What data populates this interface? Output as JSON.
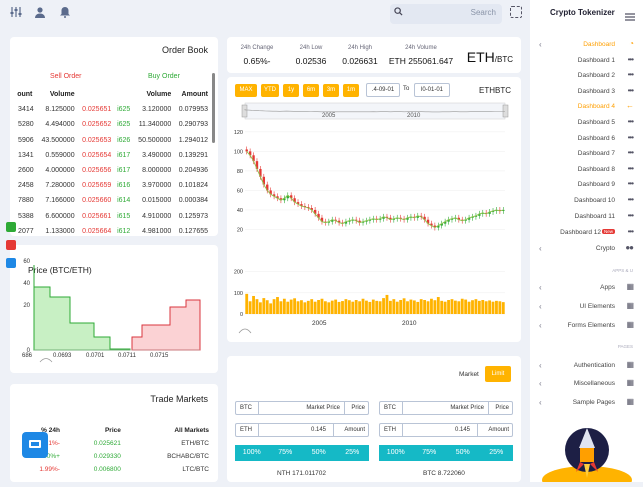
{
  "topbar": {
    "search_placeholder": "Search"
  },
  "order_book": {
    "title": "Order Book",
    "sell_label": "Sell Order",
    "buy_label": "Buy Order",
    "headers": [
      "ount",
      "Volume",
      "",
      "",
      "Volume",
      "Amount"
    ],
    "rows": [
      [
        "3414",
        "8.125000",
        "0.025651",
        "i625",
        "3.120000",
        "0.079953"
      ],
      [
        "5280",
        "4.494000",
        "0.025652",
        "i625",
        "11.340000",
        "0.290793"
      ],
      [
        "5906",
        "43.500000",
        "0.025653",
        "i626",
        "50.500000",
        "1.294012"
      ],
      [
        "1341",
        "0.559000",
        "0.025654",
        "i617",
        "3.490000",
        "0.139291"
      ],
      [
        "2600",
        "4.000000",
        "0.025656",
        "i617",
        "8.000000",
        "0.204936"
      ],
      [
        "2458",
        "7.280000",
        "0.025659",
        "i616",
        "3.970000",
        "0.101824"
      ],
      [
        "7880",
        "7.166000",
        "0.025660",
        "i614",
        "0.015000",
        "0.000384"
      ],
      [
        "5388",
        "6.600000",
        "0.025661",
        "i615",
        "4.910000",
        "0.125973"
      ],
      [
        "2077",
        "1.133000",
        "0.025664",
        "i612",
        "4.981000",
        "0.127655"
      ]
    ]
  },
  "depth": {
    "title": "Price (BTC/ETH)",
    "y_ticks": [
      "60",
      "40",
      "20",
      "0"
    ],
    "x_ticks": [
      "686",
      "0.0693",
      "0.0701",
      "0.0711",
      "0.0715"
    ]
  },
  "trade_markets": {
    "title": "Trade Markets",
    "headers": [
      "% 24h",
      "Price",
      "All Markets"
    ],
    "rows": [
      [
        "1.71%-",
        "0.025621",
        "ETH/BTC"
      ],
      [
        "00%+",
        "0.029330",
        "BCHABC/BTC"
      ],
      [
        "1.99%-",
        "0.006800",
        "LTC/BTC"
      ]
    ]
  },
  "stats": {
    "change_label": "24h Change",
    "change_value": "0.65%-",
    "low_label": "24h Low",
    "low_value": "0.02536",
    "high_label": "24h High",
    "high_value": "0.026631",
    "volume_label": "24h Volume",
    "volume_value": "ETH 255061.647",
    "pair_big": "ETH",
    "pair_small": "/BTC"
  },
  "chart_toolbar": {
    "ranges": [
      "MAX",
      "YTD",
      "1y",
      "6m",
      "3m",
      "1m"
    ],
    "from_value": ".4-09-01",
    "to_label": "To",
    "to_value": "l0-01-01",
    "symbol": "ETHBTC"
  },
  "chart_data": {
    "type": "line",
    "title": "",
    "nav_ticks": [
      "2005",
      "2010"
    ],
    "price_ticks": [
      "120",
      "100",
      "80",
      "60",
      "40",
      "20"
    ],
    "volume_ticks": [
      "200",
      "100",
      "0"
    ],
    "x_ticks": [
      "2005",
      "2010"
    ],
    "price_series": [
      100,
      96,
      90,
      82,
      74,
      66,
      60,
      56,
      54,
      52,
      50,
      52,
      55,
      52,
      48,
      46,
      44,
      43,
      42,
      40,
      36,
      32,
      28,
      27,
      28,
      30,
      29,
      27,
      26,
      28,
      29,
      30,
      29,
      27,
      28,
      29,
      30,
      31,
      30,
      31,
      33,
      32,
      30,
      31,
      32,
      31,
      30,
      32,
      33,
      32,
      34,
      33,
      30,
      26,
      24,
      22,
      24,
      26,
      28,
      30,
      31,
      32,
      30,
      29,
      30,
      32,
      33,
      34,
      36,
      37,
      36,
      38,
      39,
      40,
      39,
      40
    ],
    "volume_series": [
      95,
      60,
      85,
      70,
      55,
      75,
      65,
      50,
      70,
      80,
      60,
      72,
      58,
      68,
      74,
      60,
      65,
      55,
      62,
      70,
      58,
      66,
      72,
      60,
      55,
      63,
      68,
      57,
      61,
      70,
      65,
      58,
      66,
      60,
      72,
      63,
      57,
      68,
      62,
      60,
      75,
      90,
      62,
      70,
      58,
      66,
      74,
      60,
      68,
      64,
      57,
      70,
      66,
      60,
      72,
      65,
      80,
      62,
      58,
      66,
      70,
      63,
      60,
      72,
      68,
      58,
      65,
      70,
      62,
      66,
      60,
      64,
      58,
      62,
      60,
      56
    ],
    "price_range": [
      0,
      125
    ],
    "volume_range": [
      0,
      250
    ]
  },
  "trade": {
    "market_label": "Market",
    "limit_label": "Limit",
    "btc_label": "BTC",
    "market_price_label": "Market Price",
    "price_label": "Price",
    "eth_label": "ETH",
    "amount_value": "0.145",
    "amount_label": "Amount",
    "percents": [
      "100%",
      "75%",
      "50%",
      "25%"
    ],
    "left_total": "NTH 171.011702",
    "right_total": "BTC 8.722060"
  },
  "sidebar": {
    "title": "Crypto Tokenizer",
    "menu_icon": "hamburger-icon",
    "items": [
      {
        "label": "Dashboard",
        "active": true
      },
      {
        "label": "Dashboard 1"
      },
      {
        "label": "Dashboard 2"
      },
      {
        "label": "Dashboard 3"
      },
      {
        "label": "Dashboard 4",
        "active": true
      },
      {
        "label": "Dashboard 5"
      },
      {
        "label": "Dashboard 6"
      },
      {
        "label": "Dashboard 7"
      },
      {
        "label": "Dashboard 8"
      },
      {
        "label": "Dashboard 9"
      },
      {
        "label": "Dashboard 10"
      },
      {
        "label": "Dashboard 11"
      },
      {
        "label": "Dashboard 12",
        "badge": "New"
      },
      {
        "label": "Crypto"
      }
    ],
    "section_apps": "APPS & U",
    "apps_items": [
      {
        "label": "Apps"
      },
      {
        "label": "UI Elements"
      },
      {
        "label": "Forms Elements"
      }
    ],
    "section_pages": "PAGES",
    "pages_items": [
      {
        "label": "Authentication"
      },
      {
        "label": "Miscellaneous"
      },
      {
        "label": "Sample Pages"
      }
    ]
  },
  "colors": {
    "accent": "#ffb300",
    "buy": "#2eaa36",
    "sell": "#e53935",
    "teal": "#15b9c6",
    "brand_blue": "#1e88e5"
  }
}
